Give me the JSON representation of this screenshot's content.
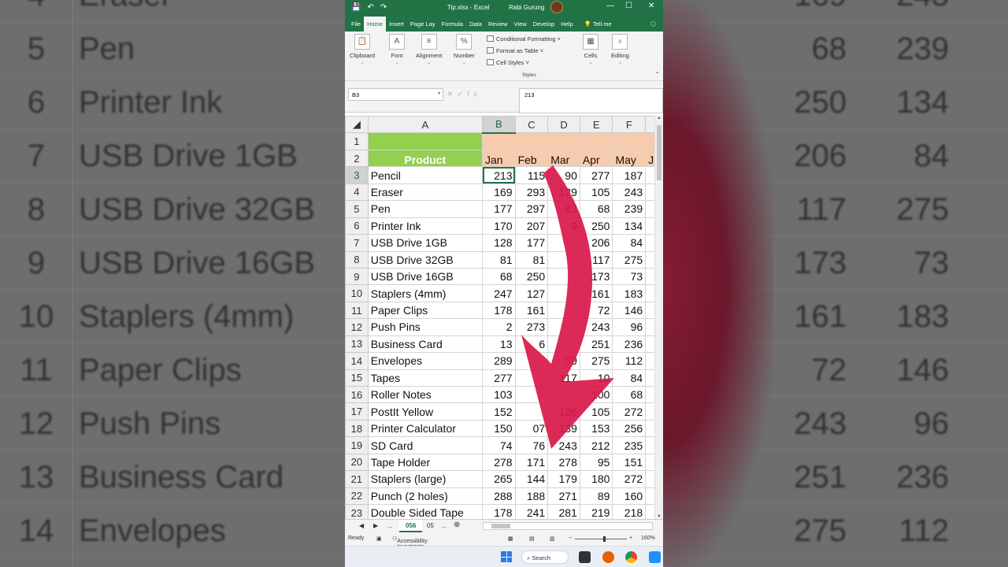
{
  "background": {
    "rows": [
      {
        "num": "4",
        "name": "Eraser",
        "v1": "169",
        "v2": "243"
      },
      {
        "num": "5",
        "name": "Pen",
        "v1": "68",
        "v2": "239"
      },
      {
        "num": "6",
        "name": "Printer Ink",
        "v1": "250",
        "v2": "134"
      },
      {
        "num": "7",
        "name": "USB Drive 1GB",
        "v1": "206",
        "v2": "84"
      },
      {
        "num": "8",
        "name": "USB Drive 32GB",
        "v1": "117",
        "v2": "275"
      },
      {
        "num": "9",
        "name": "USB Drive 16GB",
        "v1": "173",
        "v2": "73"
      },
      {
        "num": "10",
        "name": "Staplers (4mm)",
        "v1": "161",
        "v2": "183"
      },
      {
        "num": "11",
        "name": "Paper Clips",
        "v1": "72",
        "v2": "146"
      },
      {
        "num": "12",
        "name": "Push Pins",
        "v1": "243",
        "v2": "96"
      },
      {
        "num": "13",
        "name": "Business Card",
        "v1": "251",
        "v2": "236"
      },
      {
        "num": "14",
        "name": "Envelopes",
        "v1": "275",
        "v2": "112"
      }
    ]
  },
  "titlebar": {
    "filename": "Tip.xlsx  -  Excel",
    "user": "Rabi Gurung",
    "save_icon": "💾",
    "undo_icon": "↶",
    "redo_icon": "↷",
    "minimize": "—",
    "maximize": "☐",
    "close": "✕"
  },
  "tabs": [
    "File",
    "Home",
    "Insert",
    "Page Lay",
    "Formula",
    "Data",
    "Review",
    "View",
    "Develop",
    "Help"
  ],
  "tellme": "Tell me",
  "ribbon": {
    "clipboard": "Clipboard",
    "font": "Font",
    "alignment": "Alignment",
    "number": "Number",
    "number_glyph": "%",
    "font_glyph": "A",
    "conditional": "Conditional Formatting",
    "format_table": "Format as Table",
    "cell_styles": "Cell Styles",
    "styles": "Styles",
    "cells": "Cells",
    "editing": "Editing"
  },
  "formula": {
    "namebox": "B3",
    "value": "213",
    "cancel": "✕",
    "enter": "✓",
    "fx": "fx"
  },
  "columns": [
    "A",
    "B",
    "C",
    "D",
    "E",
    "F"
  ],
  "headers": {
    "product": "Product",
    "months": [
      "Jan",
      "Feb",
      "Mar",
      "Apr",
      "May",
      "Ju"
    ]
  },
  "rows": [
    {
      "n": "3",
      "name": "Pencil",
      "v": [
        "213",
        "115",
        "90",
        "277",
        "187"
      ]
    },
    {
      "n": "4",
      "name": "Eraser",
      "v": [
        "169",
        "293",
        "129",
        "105",
        "243"
      ]
    },
    {
      "n": "5",
      "name": "Pen",
      "v": [
        "177",
        "297",
        "83",
        "68",
        "239"
      ]
    },
    {
      "n": "6",
      "name": "Printer Ink",
      "v": [
        "170",
        "207",
        "9",
        "250",
        "134"
      ]
    },
    {
      "n": "7",
      "name": "USB Drive 1GB",
      "v": [
        "128",
        "177",
        "",
        "206",
        "84"
      ]
    },
    {
      "n": "8",
      "name": "USB Drive 32GB",
      "v": [
        "81",
        "81",
        "",
        "117",
        "275"
      ]
    },
    {
      "n": "9",
      "name": "USB Drive 16GB",
      "v": [
        "68",
        "250",
        "",
        "173",
        "73"
      ]
    },
    {
      "n": "10",
      "name": "Staplers (4mm)",
      "v": [
        "247",
        "127",
        "",
        "161",
        "183"
      ]
    },
    {
      "n": "11",
      "name": "Paper Clips",
      "v": [
        "178",
        "161",
        "",
        "72",
        "146"
      ]
    },
    {
      "n": "12",
      "name": "Push Pins",
      "v": [
        "2",
        "273",
        "",
        "243",
        "96"
      ]
    },
    {
      "n": "13",
      "name": "Business Card",
      "v": [
        "13",
        "6",
        "",
        "251",
        "236"
      ]
    },
    {
      "n": "14",
      "name": "Envelopes",
      "v": [
        "289",
        "",
        "59",
        "275",
        "112"
      ]
    },
    {
      "n": "15",
      "name": "Tapes",
      "v": [
        "277",
        "",
        "117",
        "10",
        "84"
      ]
    },
    {
      "n": "16",
      "name": "Roller Notes",
      "v": [
        "103",
        "",
        "",
        "100",
        "68"
      ]
    },
    {
      "n": "17",
      "name": "PostIt Yellow",
      "v": [
        "152",
        "",
        "126",
        "105",
        "272"
      ]
    },
    {
      "n": "18",
      "name": "Printer Calculator",
      "v": [
        "150",
        "07",
        "139",
        "153",
        "256"
      ]
    },
    {
      "n": "19",
      "name": "SD Card",
      "v": [
        "74",
        "76",
        "243",
        "212",
        "235"
      ]
    },
    {
      "n": "20",
      "name": "Tape Holder",
      "v": [
        "278",
        "171",
        "278",
        "95",
        "151"
      ]
    },
    {
      "n": "21",
      "name": "Staplers (large)",
      "v": [
        "265",
        "144",
        "179",
        "180",
        "272"
      ]
    },
    {
      "n": "22",
      "name": "Punch (2 holes)",
      "v": [
        "288",
        "188",
        "271",
        "89",
        "160"
      ]
    },
    {
      "n": "23",
      "name": "Double Sided Tape",
      "v": [
        "178",
        "241",
        "281",
        "219",
        "218"
      ]
    }
  ],
  "sheetbar": {
    "ellipsis1": "...",
    "active_tab": "056",
    "next_tab": "05",
    "ellipsis2": "...",
    "add": "⊕"
  },
  "status": {
    "ready": "Ready",
    "accessibility": "Accessibility: Investigate",
    "zoom": "160%"
  },
  "taskbar": {
    "search": "Search"
  },
  "colors": {
    "excel_green": "#217346",
    "product_header": "#92d050",
    "month_header": "#f8cbad",
    "arrow": "#d8184a"
  }
}
